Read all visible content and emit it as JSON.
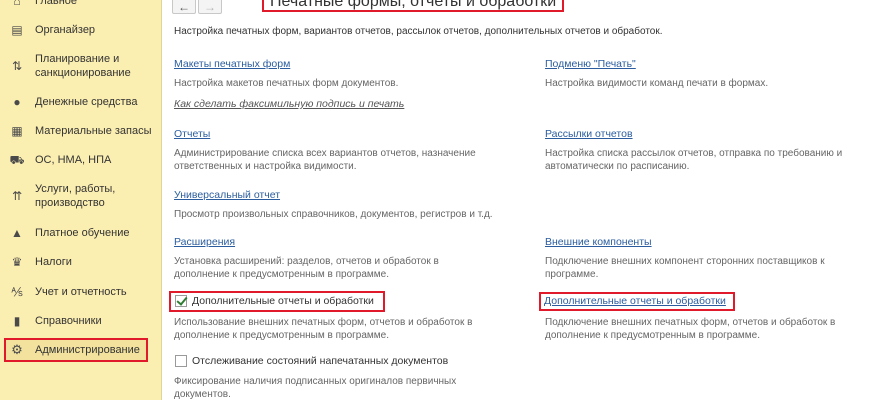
{
  "sidebar": {
    "items": [
      {
        "label": "Главное",
        "icon": "home-icon"
      },
      {
        "label": "Органайзер",
        "icon": "organizer-icon"
      },
      {
        "label": "Планирование и санкционирование",
        "icon": "planning-icon"
      },
      {
        "label": "Денежные средства",
        "icon": "money-icon"
      },
      {
        "label": "Материальные запасы",
        "icon": "inventory-icon"
      },
      {
        "label": "ОС, НМА, НПА",
        "icon": "truck-icon"
      },
      {
        "label": "Услуги, работы, производство",
        "icon": "services-icon"
      },
      {
        "label": "Платное обучение",
        "icon": "graduation-cap-icon"
      },
      {
        "label": "Налоги",
        "icon": "taxes-icon"
      },
      {
        "label": "Учет и отчетность",
        "icon": "accounting-icon"
      },
      {
        "label": "Справочники",
        "icon": "books-icon"
      },
      {
        "label": "Администрирование",
        "icon": "gear-icon"
      }
    ],
    "active": "Администрирование"
  },
  "header": {
    "back_icon": "arrow-left-icon",
    "forward_icon": "arrow-right-icon",
    "title": "Печатные формы, отчеты и обработки",
    "description": "Настройка печатных форм, вариантов отчетов, рассылок отчетов, дополнительных отчетов и обработок."
  },
  "left_column": {
    "print_layouts": {
      "link": "Макеты печатных форм",
      "desc": "Настройка макетов печатных форм документов."
    },
    "facsimile_link": "Как сделать факсимильную подпись и печать",
    "reports": {
      "link": "Отчеты",
      "desc1": "Администрирование списка всех вариантов отчетов, назначение",
      "desc2": "ответственных и настройка видимости."
    },
    "universal_report": {
      "link": "Универсальный отчет",
      "desc": "Просмотр произвольных справочников, документов, регистров и т.д."
    },
    "extensions": {
      "link": "Расширения",
      "desc1": "Установка расширений: разделов, отчетов и обработок в",
      "desc2": "дополнение к предусмотренным в программе."
    },
    "additional_reports_checkbox": {
      "label": "Дополнительные отчеты и обработки",
      "checked": true,
      "desc1": "Использование внешних печатных форм, отчетов и обработок в",
      "desc2": "дополнение к предусмотренным в программе."
    },
    "tracking_checkbox": {
      "label": "Отслеживание состояний напечатанных документов",
      "checked": false,
      "desc1": "Фиксирование наличия подписанных оригиналов первичных",
      "desc2": "документов."
    }
  },
  "right_column": {
    "print_substitution": {
      "link": "Подменю \"Печать\"",
      "desc": "Настройка видимости команд печати в формах."
    },
    "report_mailings": {
      "link": "Рассылки отчетов",
      "desc1": "Настройка списка рассылок отчетов, отправка по требованию и",
      "desc2": "автоматически по расписанию."
    },
    "external_components": {
      "link": "Внешние компоненты",
      "desc1": "Подключение внешних компонент сторонних поставщиков к",
      "desc2": "программе."
    },
    "additional_reports_link": {
      "link": "Дополнительные отчеты и обработки",
      "desc1": "Подключение внешних печатных форм, отчетов и обработок в",
      "desc2": "дополнение к предусмотренным в программе."
    }
  },
  "colors": {
    "sidebar_bg": "#fbeeb1",
    "link": "#2b5d9e",
    "highlight": "#e0192b",
    "check": "#2f7d32"
  }
}
